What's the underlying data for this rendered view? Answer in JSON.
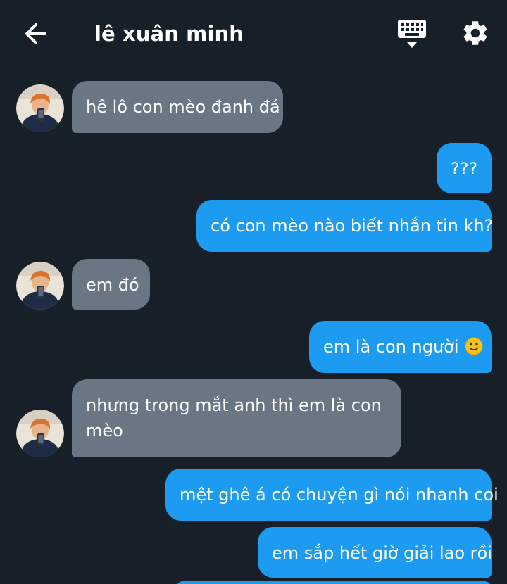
{
  "header": {
    "title": "lê xuân minh",
    "back_icon": "arrow-left-icon",
    "keyboard_icon": "keyboard-icon",
    "settings_icon": "gear-icon"
  },
  "messages": [
    {
      "side": "in",
      "text": "hê lô con mèo đanh đá"
    },
    {
      "side": "out",
      "text": "???"
    },
    {
      "side": "out",
      "text": "có con mèo nào biết nhắn tin kh?"
    },
    {
      "side": "in",
      "text": "em đó"
    },
    {
      "side": "out",
      "text": "em là con người",
      "emoji": "slightly-smiling-face-emoji"
    },
    {
      "side": "in",
      "text_line1": "nhưng trong mắt anh thì em là con",
      "text_line2": "mèo"
    },
    {
      "side": "out",
      "text": "mệt ghê á có chuyện gì nói nhanh coi"
    },
    {
      "side": "out",
      "text": "em sắp hết giờ giải lao rồi"
    }
  ],
  "colors": {
    "background": "#172029",
    "incoming_bubble": "#6a7683",
    "outgoing_bubble": "#1d9bf0",
    "text": "#ffffff"
  }
}
